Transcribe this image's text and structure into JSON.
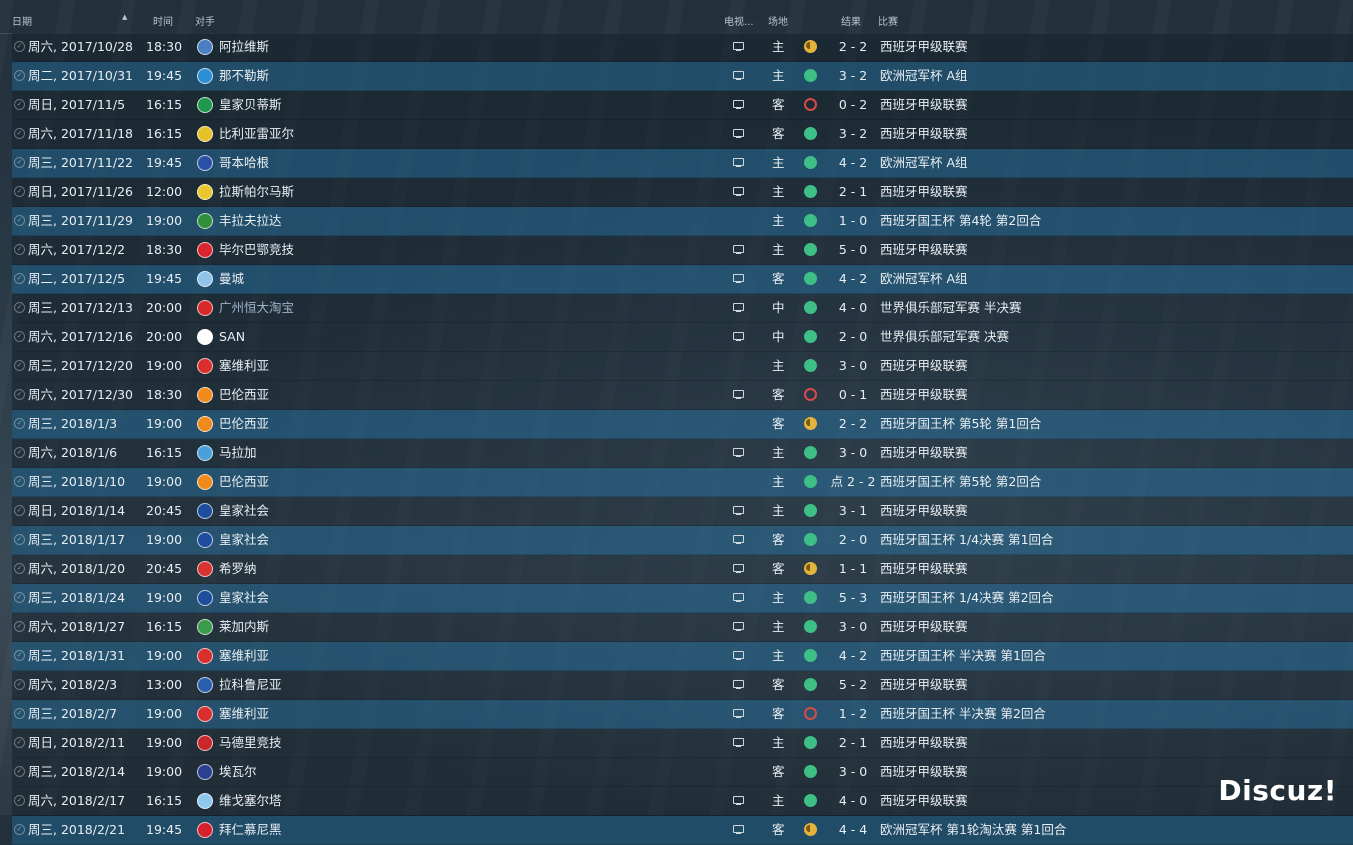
{
  "header": {
    "date": "日期",
    "time": "时间",
    "opponent": "对手",
    "tv": "电视...",
    "venue": "场地",
    "result": "结果",
    "competition": "比赛"
  },
  "colors": {
    "win": "#3dbf85",
    "draw": "#e3b33c",
    "loss": "#d94a4a",
    "highlight_row": "#20587a"
  },
  "matches": [
    {
      "date": "周六, 2017/10/28",
      "time": "18:30",
      "opponent": "阿拉维斯",
      "crest": "#4a7fc1",
      "tv": true,
      "venue": "主",
      "result": "D",
      "score": "2 - 2",
      "competition": "西班牙甲级联赛",
      "highlight": false
    },
    {
      "date": "周二, 2017/10/31",
      "time": "19:45",
      "opponent": "那不勒斯",
      "crest": "#2a8fd6",
      "tv": true,
      "venue": "主",
      "result": "W",
      "score": "3 - 2",
      "competition": "欧洲冠军杯 A组",
      "highlight": true
    },
    {
      "date": "周日, 2017/11/5",
      "time": "16:15",
      "opponent": "皇家贝蒂斯",
      "crest": "#1f9a4c",
      "tv": true,
      "venue": "客",
      "result": "L",
      "score": "0 - 2",
      "competition": "西班牙甲级联赛",
      "highlight": false
    },
    {
      "date": "周六, 2017/11/18",
      "time": "16:15",
      "opponent": "比利亚雷亚尔",
      "crest": "#e6c22a",
      "tv": true,
      "venue": "客",
      "result": "W",
      "score": "3 - 2",
      "competition": "西班牙甲级联赛",
      "highlight": false
    },
    {
      "date": "周三, 2017/11/22",
      "time": "19:45",
      "opponent": "哥本哈根",
      "crest": "#2c4fa8",
      "tv": true,
      "venue": "主",
      "result": "W",
      "score": "4 - 2",
      "competition": "欧洲冠军杯 A组",
      "highlight": true
    },
    {
      "date": "周日, 2017/11/26",
      "time": "12:00",
      "opponent": "拉斯帕尔马斯",
      "crest": "#e8c62e",
      "tv": true,
      "venue": "主",
      "result": "W",
      "score": "2 - 1",
      "competition": "西班牙甲级联赛",
      "highlight": false
    },
    {
      "date": "周三, 2017/11/29",
      "time": "19:00",
      "opponent": "丰拉夫拉达",
      "crest": "#2f8f3a",
      "tv": false,
      "venue": "主",
      "result": "W",
      "score": "1 - 0",
      "competition": "西班牙国王杯 第4轮 第2回合",
      "highlight": true
    },
    {
      "date": "周六, 2017/12/2",
      "time": "18:30",
      "opponent": "毕尔巴鄂竞技",
      "crest": "#d8252d",
      "tv": true,
      "venue": "主",
      "result": "W",
      "score": "5 - 0",
      "competition": "西班牙甲级联赛",
      "highlight": false
    },
    {
      "date": "周二, 2017/12/5",
      "time": "19:45",
      "opponent": "曼城",
      "crest": "#8fc3e8",
      "tv": true,
      "venue": "客",
      "result": "W",
      "score": "4 - 2",
      "competition": "欧洲冠军杯 A组",
      "highlight": true
    },
    {
      "date": "周三, 2017/12/13",
      "time": "20:00",
      "opponent": "广州恒大淘宝",
      "crest": "#d62a2a",
      "tv": true,
      "venue": "中",
      "result": "W",
      "score": "4 - 0",
      "competition": "世界俱乐部冠军赛 半决赛",
      "highlight": false,
      "link": true
    },
    {
      "date": "周六, 2017/12/16",
      "time": "20:00",
      "opponent": "SAN",
      "crest": "#ffffff",
      "tv": true,
      "venue": "中",
      "result": "W",
      "score": "2 - 0",
      "competition": "世界俱乐部冠军赛 决赛",
      "highlight": false
    },
    {
      "date": "周三, 2017/12/20",
      "time": "19:00",
      "opponent": "塞维利亚",
      "crest": "#d9302f",
      "tv": false,
      "venue": "主",
      "result": "W",
      "score": "3 - 0",
      "competition": "西班牙甲级联赛",
      "highlight": false
    },
    {
      "date": "周六, 2017/12/30",
      "time": "18:30",
      "opponent": "巴伦西亚",
      "crest": "#f08a1c",
      "tv": true,
      "venue": "客",
      "result": "L",
      "score": "0 - 1",
      "competition": "西班牙甲级联赛",
      "highlight": false
    },
    {
      "date": "周三, 2018/1/3",
      "time": "19:00",
      "opponent": "巴伦西亚",
      "crest": "#f08a1c",
      "tv": false,
      "venue": "客",
      "result": "D",
      "score": "2 - 2",
      "competition": "西班牙国王杯 第5轮 第1回合",
      "highlight": true
    },
    {
      "date": "周六, 2018/1/6",
      "time": "16:15",
      "opponent": "马拉加",
      "crest": "#4aa0d8",
      "tv": true,
      "venue": "主",
      "result": "W",
      "score": "3 - 0",
      "competition": "西班牙甲级联赛",
      "highlight": false
    },
    {
      "date": "周三, 2018/1/10",
      "time": "19:00",
      "opponent": "巴伦西亚",
      "crest": "#f08a1c",
      "tv": false,
      "venue": "主",
      "result": "W",
      "score": "点 2 - 2",
      "competition": "西班牙国王杯 第5轮 第2回合",
      "highlight": true
    },
    {
      "date": "周日, 2018/1/14",
      "time": "20:45",
      "opponent": "皇家社会",
      "crest": "#1d4d9c",
      "tv": true,
      "venue": "主",
      "result": "W",
      "score": "3 - 1",
      "competition": "西班牙甲级联赛",
      "highlight": false
    },
    {
      "date": "周三, 2018/1/17",
      "time": "19:00",
      "opponent": "皇家社会",
      "crest": "#1d4d9c",
      "tv": true,
      "venue": "客",
      "result": "W",
      "score": "2 - 0",
      "competition": "西班牙国王杯 1/4决赛 第1回合",
      "highlight": true
    },
    {
      "date": "周六, 2018/1/20",
      "time": "20:45",
      "opponent": "希罗纳",
      "crest": "#d63333",
      "tv": true,
      "venue": "客",
      "result": "D",
      "score": "1 - 1",
      "competition": "西班牙甲级联赛",
      "highlight": false
    },
    {
      "date": "周三, 2018/1/24",
      "time": "19:00",
      "opponent": "皇家社会",
      "crest": "#1d4d9c",
      "tv": true,
      "venue": "主",
      "result": "W",
      "score": "5 - 3",
      "competition": "西班牙国王杯 1/4决赛 第2回合",
      "highlight": true
    },
    {
      "date": "周六, 2018/1/27",
      "time": "16:15",
      "opponent": "莱加内斯",
      "crest": "#3a9c4a",
      "tv": true,
      "venue": "主",
      "result": "W",
      "score": "3 - 0",
      "competition": "西班牙甲级联赛",
      "highlight": false
    },
    {
      "date": "周三, 2018/1/31",
      "time": "19:00",
      "opponent": "塞维利亚",
      "crest": "#d9302f",
      "tv": true,
      "venue": "主",
      "result": "W",
      "score": "4 - 2",
      "competition": "西班牙国王杯 半决赛 第1回合",
      "highlight": true
    },
    {
      "date": "周六, 2018/2/3",
      "time": "13:00",
      "opponent": "拉科鲁尼亚",
      "crest": "#2a5fb0",
      "tv": true,
      "venue": "客",
      "result": "W",
      "score": "5 - 2",
      "competition": "西班牙甲级联赛",
      "highlight": false
    },
    {
      "date": "周三, 2018/2/7",
      "time": "19:00",
      "opponent": "塞维利亚",
      "crest": "#d9302f",
      "tv": true,
      "venue": "客",
      "result": "L",
      "score": "1 - 2",
      "competition": "西班牙国王杯 半决赛 第2回合",
      "highlight": true
    },
    {
      "date": "周日, 2018/2/11",
      "time": "19:00",
      "opponent": "马德里竞技",
      "crest": "#c8282c",
      "tv": true,
      "venue": "主",
      "result": "W",
      "score": "2 - 1",
      "competition": "西班牙甲级联赛",
      "highlight": false
    },
    {
      "date": "周三, 2018/2/14",
      "time": "19:00",
      "opponent": "埃瓦尔",
      "crest": "#2a3f8f",
      "tv": false,
      "venue": "客",
      "result": "W",
      "score": "3 - 0",
      "competition": "西班牙甲级联赛",
      "highlight": false
    },
    {
      "date": "周六, 2018/2/17",
      "time": "16:15",
      "opponent": "维戈塞尔塔",
      "crest": "#8ec8ec",
      "tv": true,
      "venue": "主",
      "result": "W",
      "score": "4 - 0",
      "competition": "西班牙甲级联赛",
      "highlight": false
    },
    {
      "date": "周三, 2018/2/21",
      "time": "19:45",
      "opponent": "拜仁慕尼黑",
      "crest": "#d4222b",
      "tv": true,
      "venue": "客",
      "result": "D",
      "score": "4 - 4",
      "competition": "欧洲冠军杯 第1轮淘汰赛 第1回合",
      "highlight": true
    }
  ],
  "watermark": "Discuz!"
}
